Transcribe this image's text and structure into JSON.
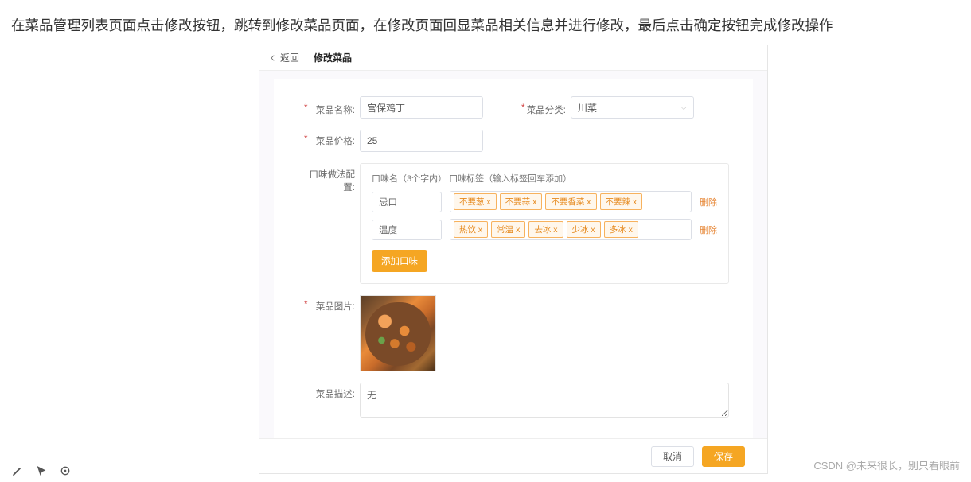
{
  "intro": "在菜品管理列表页面点击修改按钮，跳转到修改菜品页面，在修改页面回显菜品相关信息并进行修改，最后点击确定按钮完成修改操作",
  "header": {
    "back": "返回",
    "title": "修改菜品"
  },
  "form": {
    "name_label": "菜品名称:",
    "name_value": "宫保鸡丁",
    "category_label": "菜品分类:",
    "category_value": "川菜",
    "price_label": "菜品价格:",
    "price_value": "25",
    "flavor_label": "口味做法配置:",
    "flavor_head_name": "口味名（3个字内）",
    "flavor_head_tags": "口味标签（输入标签回车添加）",
    "flavors": [
      {
        "name": "忌口",
        "tags": [
          "不要葱 x",
          "不要蒜 x",
          "不要香菜 x",
          "不要辣 x"
        ],
        "del": "删除"
      },
      {
        "name": "温度",
        "tags": [
          "热饮 x",
          "常温 x",
          "去冰 x",
          "少冰 x",
          "多冰 x"
        ],
        "del": "删除"
      }
    ],
    "add_flavor": "添加口味",
    "image_label": "菜品图片:",
    "desc_label": "菜品描述:",
    "desc_value": "无"
  },
  "footer": {
    "cancel": "取消",
    "save": "保存"
  },
  "watermark": "CSDN @未来很长，别只看眼前"
}
